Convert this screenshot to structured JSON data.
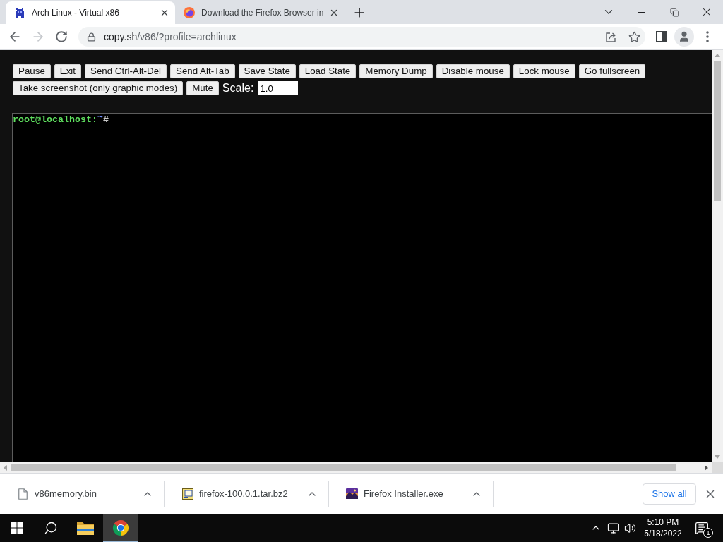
{
  "browser": {
    "tabs": [
      {
        "title": "Arch Linux - Virtual x86",
        "kind": "pixel",
        "selected": true
      },
      {
        "title": "Download the Firefox Browser in",
        "kind": "globe",
        "selected": false
      }
    ],
    "nav_buttons": [
      {
        "kind": "back",
        "disabled": false
      },
      {
        "kind": "forward",
        "disabled": true
      },
      {
        "kind": "reload",
        "disabled": false
      }
    ],
    "address_bar": {
      "host": "copy.sh",
      "path": "/v86/?profile=archlinux"
    }
  },
  "page": {
    "button_rows": [
      {
        "buttons": [
          "Pause",
          "Exit",
          "Send Ctrl-Alt-Del",
          "Send Alt-Tab",
          "Save State",
          "Load State",
          "Memory Dump",
          "Disable mouse",
          "Lock mouse",
          "Go fullscreen"
        ]
      },
      {
        "buttons": [
          "Take screenshot (only graphic modes)",
          "Mute"
        ],
        "scale": {
          "label": "Scale:",
          "value": "1.0"
        }
      }
    ],
    "terminal": {
      "prompt": [
        {
          "text": "root@localhost:",
          "kind": "host"
        },
        {
          "text": "~",
          "kind": "path"
        },
        {
          "text": "#",
          "kind": "symbol"
        }
      ]
    }
  },
  "downloads": {
    "items": [
      {
        "name": "v86memory.bin",
        "kind": "file"
      },
      {
        "name": "firefox-100.0.1.tar.bz2",
        "kind": "archive"
      },
      {
        "name": "Firefox Installer.exe",
        "kind": "installer"
      }
    ],
    "show_all": "Show all"
  },
  "taskbar": {
    "apps": [
      {
        "kind": "start",
        "selected": false
      },
      {
        "kind": "search",
        "selected": false
      },
      {
        "kind": "explorer",
        "selected": false
      },
      {
        "kind": "chrome",
        "selected": true
      }
    ],
    "clock": {
      "time": "5:10 PM",
      "date": "5/18/2022"
    },
    "notifications": {
      "count": "1"
    }
  }
}
